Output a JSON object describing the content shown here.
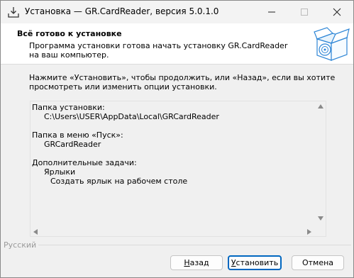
{
  "window": {
    "title": "Установка — GR.CardReader, версия 5.0.1.0"
  },
  "header": {
    "title": "Всё готово к установке",
    "description": "Программа установки готова начать установку GR.CardReader на ваш компьютер."
  },
  "intro": "Нажмите «Установить», чтобы продолжить, или «Назад», если вы хотите просмотреть или изменить опции установки.",
  "memo": {
    "install_folder_label": "Папка установки:",
    "install_folder_value": "C:\\Users\\USER\\AppData\\Local\\GRCardReader",
    "start_menu_label": "Папка в меню «Пуск»:",
    "start_menu_value": "GRCardReader",
    "tasks_label": "Дополнительные задачи:",
    "tasks_group": "Ярлыки",
    "tasks_item": "Создать ярлык на рабочем столе"
  },
  "language_label": "Русский",
  "buttons": {
    "back": {
      "prefix": "",
      "hotkey": "Н",
      "suffix": "азад"
    },
    "install": {
      "prefix": "",
      "hotkey": "У",
      "suffix": "становить"
    },
    "cancel": "Отмена"
  },
  "colors": {
    "accent": "#0067c0",
    "header_bg": "#ffffff",
    "window_bg": "#f0f0f0"
  }
}
